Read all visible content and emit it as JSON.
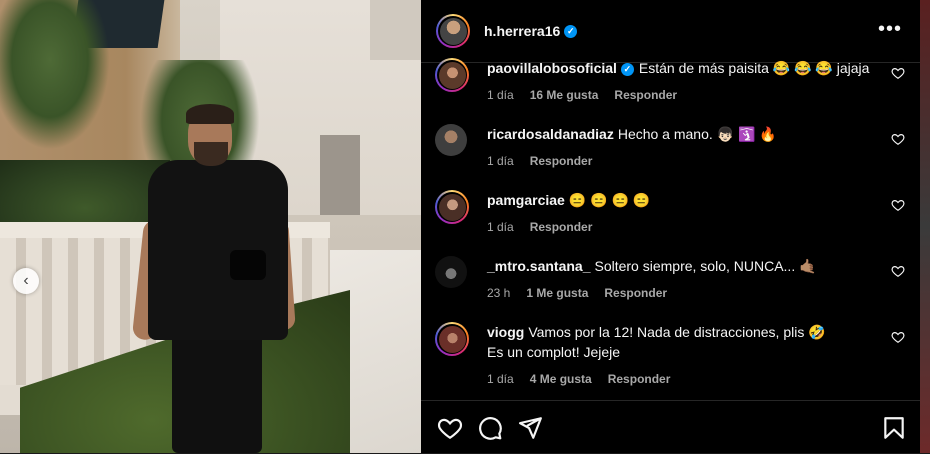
{
  "post": {
    "author": "h.herrera16",
    "more_icon": "more-horizontal-icon"
  },
  "comments": [
    {
      "user": "paovillalobosoficial",
      "verified": true,
      "text": "Están de más paisita 😂 😂 😂  jajaja",
      "time": "1 día",
      "likes": "16 Me gusta",
      "reply": "Responder",
      "avatar_color": "#8a5a44"
    },
    {
      "user": "ricardosaldanadiaz",
      "verified": false,
      "text": "Hecho a mano. 👦🏻 🛐 🔥",
      "time": "1 día",
      "likes": "",
      "reply": "Responder",
      "avatar_color": "#5b5b5b"
    },
    {
      "user": "pamgarciae",
      "verified": false,
      "text": "😑 😑 😑 😑",
      "time": "1 día",
      "likes": "",
      "reply": "Responder",
      "avatar_color": "#6b4a3e"
    },
    {
      "user": "_mtro.santana_",
      "verified": false,
      "text": "Soltero siempre, solo, NUNCA... 🤙🏽",
      "time": "23 h",
      "likes": "1 Me gusta",
      "reply": "Responder",
      "avatar_color": "#2b2b2b"
    },
    {
      "user": "viogg",
      "verified": false,
      "text": "Vamos por la 12! Nada de distracciones, plis 🤣",
      "text2": "Es un complot! Jejeje",
      "time": "1 día",
      "likes": "4 Me gusta",
      "reply": "Responder",
      "avatar_color": "#7a3a30"
    }
  ],
  "actions": {
    "like": "heart-icon",
    "comment": "comment-icon",
    "share": "send-icon",
    "save": "bookmark-icon"
  },
  "colors": {
    "verified": "#0095f6",
    "panel_bg": "#000000",
    "meta_text": "#a8a8a8"
  }
}
